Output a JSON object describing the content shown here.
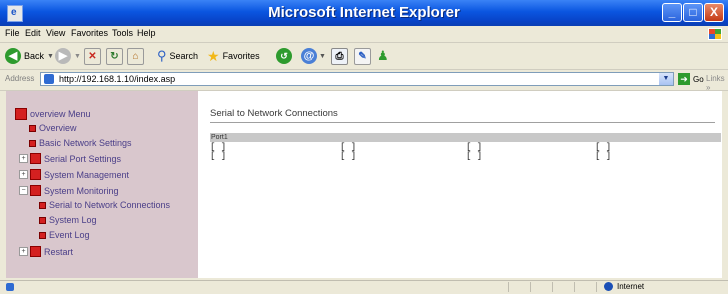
{
  "window": {
    "title": "Microsoft Internet Explorer",
    "controls": [
      "_",
      "□",
      "X"
    ]
  },
  "menubar": {
    "items": [
      "File",
      "Edit",
      "View",
      "Favorites",
      "Tools",
      "Help"
    ]
  },
  "toolbar": {
    "back_label": "Back",
    "search_label": "Search",
    "favorites_label": "Favorites"
  },
  "address": {
    "label": "Address",
    "url": "http://192.168.1.10/index.asp",
    "go_label": "Go",
    "links_label": "Links"
  },
  "sidebar": {
    "items": [
      {
        "label": "overview Menu"
      },
      {
        "label": "Overview"
      },
      {
        "label": "Basic Network Settings"
      },
      {
        "label": "Serial Port Settings"
      },
      {
        "label": "System Management"
      },
      {
        "label": "System Monitoring"
      },
      {
        "label": "Serial to Network Connections"
      },
      {
        "label": "System Log"
      },
      {
        "label": "Event Log"
      },
      {
        "label": "Restart"
      }
    ]
  },
  "main": {
    "title": "Serial to Network Connections",
    "table": {
      "header": "Port1",
      "rows": [
        [
          "[ ]",
          "[ ]",
          "[ ]",
          "[ ]"
        ],
        [
          "[ ]",
          "[ ]",
          "[ ]",
          "[ ]"
        ]
      ]
    }
  },
  "statusbar": {
    "zone": "Internet"
  },
  "colors": {
    "titlebar": "#0a55e0",
    "sidebar_bg": "#d9c7cd",
    "sidebar_text": "#4a3e88",
    "tree_icon": "#d42020"
  }
}
